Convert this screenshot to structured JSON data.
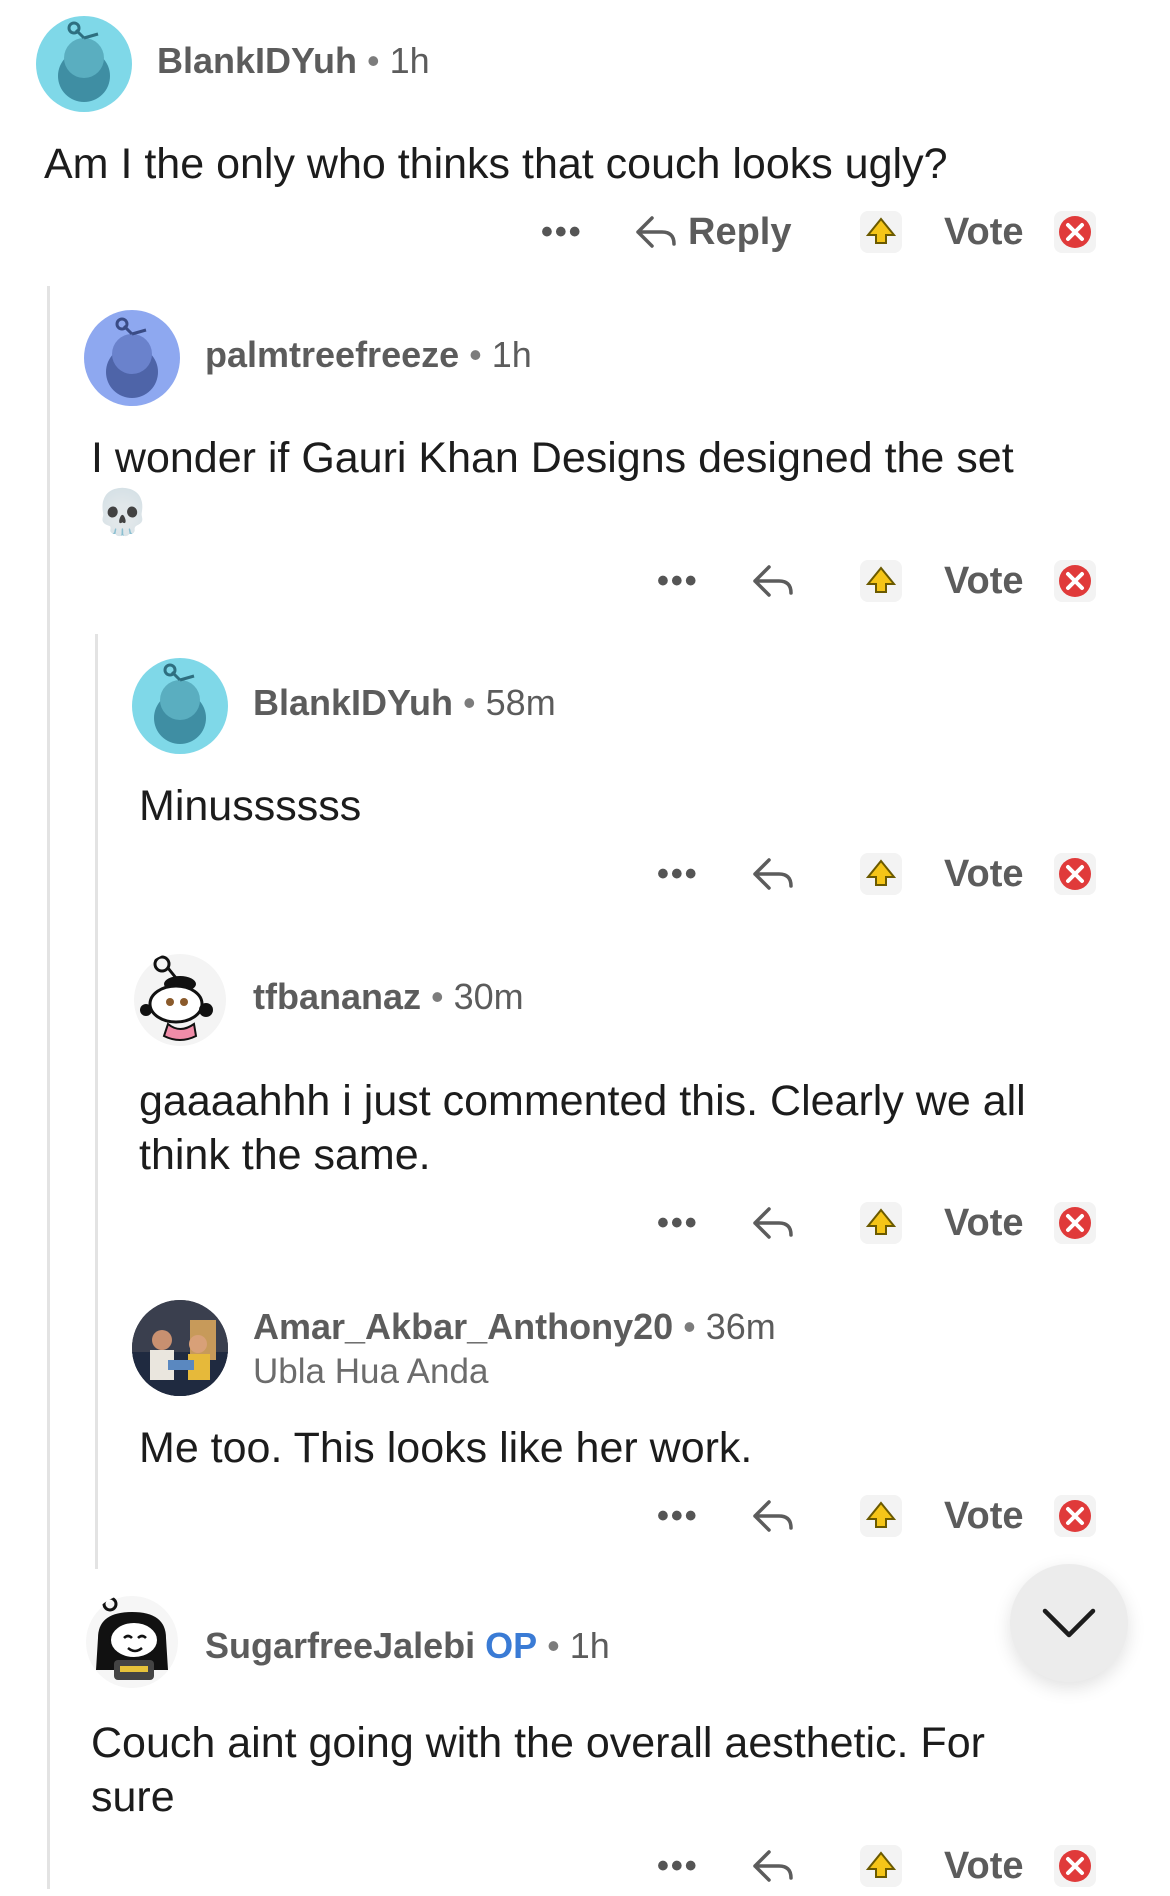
{
  "comments": [
    {
      "username": "BlankIDYuh",
      "separator": "•",
      "time": "1h",
      "body": "Am I the only who thinks that couch looks ugly?",
      "more": "•••",
      "reply_label": "Reply",
      "vote_label": "Vote"
    },
    {
      "username": "palmtreefreeze",
      "separator": "•",
      "time": "1h",
      "body": "I wonder if Gauri Khan Designs designed the set",
      "emoji": "💀",
      "more": "•••",
      "vote_label": "Vote"
    },
    {
      "username": "BlankIDYuh",
      "separator": "•",
      "time": "58m",
      "body": "Minussssss",
      "more": "•••",
      "vote_label": "Vote"
    },
    {
      "username": "tfbananaz",
      "separator": "•",
      "time": "30m",
      "body_line1": "gaaaahhh i just commented this. Clearly we all",
      "body_line2": "think the same.",
      "more": "•••",
      "vote_label": "Vote"
    },
    {
      "username": "Amar_Akbar_Anthony20",
      "separator": "•",
      "time": "36m",
      "flair": "Ubla Hua Anda",
      "body": "Me too. This looks like her work.",
      "more": "•••",
      "vote_label": "Vote"
    },
    {
      "username": "SugarfreeJalebi",
      "op_tag": "OP",
      "separator": "•",
      "time": "1h",
      "body_line1": "Couch aint going with the overall aesthetic. For",
      "body_line2": "sure",
      "more": "•••",
      "vote_label": "Vote"
    }
  ],
  "icons": {
    "avatar_colors": {
      "teal": "#7fd8e8",
      "periwinkle": "#8ea8f0"
    },
    "upvote_color": "#f5c518",
    "downvote_color": "#e03a3a"
  }
}
